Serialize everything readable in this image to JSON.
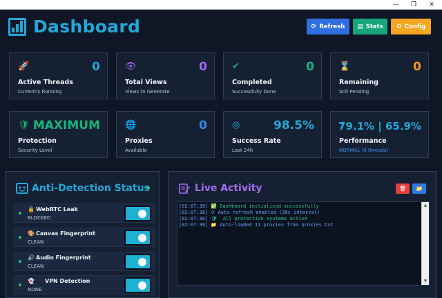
{
  "window": {
    "minimize": "—",
    "maximize": "❐",
    "close": "✕"
  },
  "header": {
    "title": "Dashboard",
    "buttons": {
      "refresh": {
        "label": "Refresh",
        "icon": "⟳"
      },
      "stats": {
        "label": "Stats",
        "icon": "▤"
      },
      "config": {
        "label": "Config",
        "icon": "⚙"
      }
    }
  },
  "cards": [
    {
      "icon": "🚀",
      "value": "0",
      "title": "Active Threads",
      "subtitle": "Currently Running"
    },
    {
      "icon": "👁",
      "value": "0",
      "title": "Total Views",
      "subtitle": "Views to Generate"
    },
    {
      "icon": "✔",
      "value": "0",
      "title": "Completed",
      "subtitle": "Successfully Done"
    },
    {
      "icon": "⌛",
      "value": "0",
      "title": "Remaining",
      "subtitle": "Still Pending"
    },
    {
      "icon": "🛡",
      "value": "MAXIMUM",
      "title": "Protection",
      "subtitle": "Security Level"
    },
    {
      "icon": "🌐",
      "value": "0",
      "title": "Proxies",
      "subtitle": "Available"
    },
    {
      "icon": "◎",
      "value": "98.5%",
      "title": "Success Rate",
      "subtitle": "Last 24h"
    },
    {
      "icon": "⚡",
      "value": "79.1% | 65.9%",
      "title": "Performance",
      "subtitle": "NORMAL (0 threads)"
    }
  ],
  "colors": {
    "active_threads": "#23a7d8",
    "total_views": "#a46bf0",
    "completed": "#17b584",
    "remaining": "#f39c12",
    "protection": "#19b37a",
    "proxies": "#2f8fe8",
    "success_rate": "#23a7d8",
    "performance": "#23a7d8",
    "performance_sub": "#3d8ef0"
  },
  "anti_detection": {
    "title": "Anti-Detection Status",
    "items": [
      {
        "icon": "🔒",
        "name": "WebRTC Leak",
        "status": "BLOCKED",
        "enabled": true
      },
      {
        "icon": "🎨",
        "name": "Canvas Fingerprint",
        "status": "CLEAN",
        "enabled": true
      },
      {
        "icon": "🔊",
        "name": "Audio Fingerprint",
        "status": "CLEAN",
        "enabled": true
      },
      {
        "icon": "👻",
        "name": "VPN Detection",
        "status": "NONE",
        "enabled": true
      }
    ]
  },
  "activity": {
    "title": "Live Activity",
    "clear_icon": "🗑",
    "folder_icon": "📁",
    "log": [
      {
        "time": "[02:07:38]",
        "icon": "✅",
        "text": "Dashboard initialized successfully",
        "level": "success"
      },
      {
        "time": "[02:07:38]",
        "icon": "⟳",
        "text": "Auto-refresh enabled (30s interval)",
        "level": "info"
      },
      {
        "time": "[02:07:38]",
        "icon": "🛡",
        "text": "  All protection systems active",
        "level": "success"
      },
      {
        "time": "[02:07:38]",
        "icon": "📁",
        "text": "Auto-loaded 11 proxies from proxies.txt",
        "level": "info"
      }
    ]
  }
}
